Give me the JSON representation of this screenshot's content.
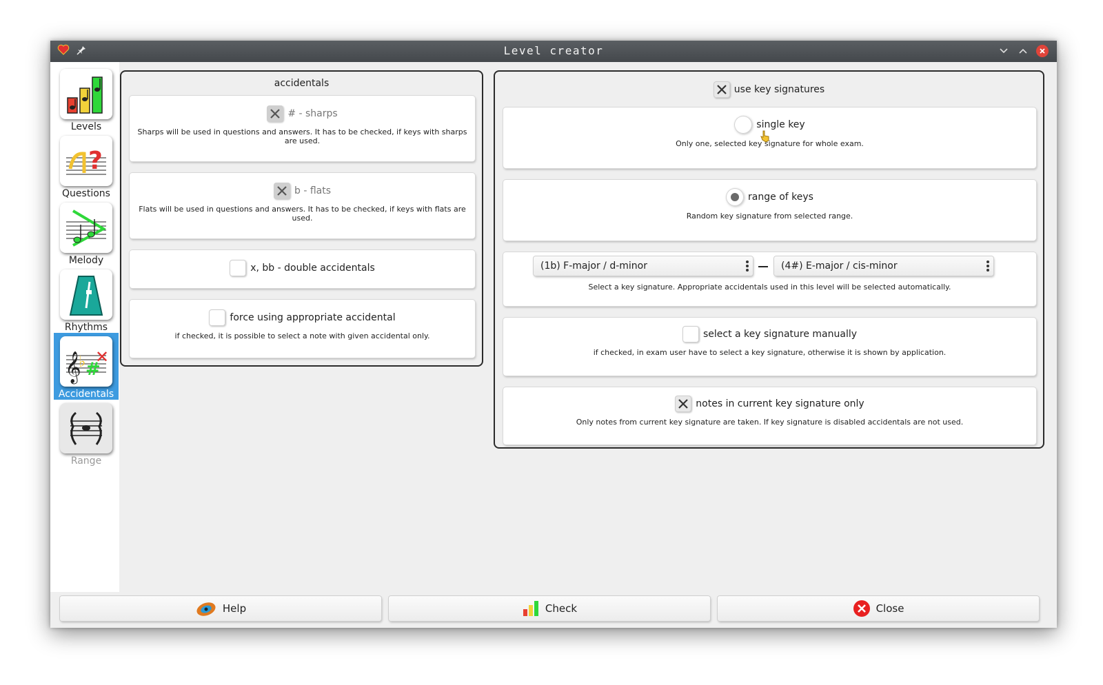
{
  "window": {
    "title": "Level creator"
  },
  "sidebar": {
    "items": [
      {
        "label": "Levels"
      },
      {
        "label": "Questions"
      },
      {
        "label": "Melody"
      },
      {
        "label": "Rhythms"
      },
      {
        "label": "Accidentals"
      },
      {
        "label": "Range"
      }
    ]
  },
  "accidentals": {
    "title": "accidentals",
    "sharps": {
      "label": "# - sharps",
      "checked": true,
      "desc": "Sharps will be used in questions and answers. It has to be checked, if keys with sharps are used."
    },
    "flats": {
      "label": "b - flats",
      "checked": true,
      "desc": "Flats will be used in questions and answers. It has to be checked, if keys with flats are used."
    },
    "double": {
      "label": "x, bb - double accidentals",
      "checked": false
    },
    "force": {
      "label": "force using appropriate accidental",
      "checked": false,
      "desc": "if checked, it is possible to select a note with given accidental only."
    }
  },
  "keys": {
    "use_key_signatures": {
      "label": "use key signatures",
      "checked": true
    },
    "single_key": {
      "label": "single key",
      "selected": false,
      "desc": "Only one, selected key signature for whole exam."
    },
    "range_of_keys": {
      "label": "range of keys",
      "selected": true,
      "desc": "Random key signature from selected range."
    },
    "range": {
      "from": "(1b) F-major / d-minor",
      "to": "(4#) E-major / cis-minor",
      "desc": "Select a key signature. Appropriate accidentals used in this level will be selected automatically."
    },
    "manual": {
      "label": "select a key signature manually",
      "checked": false,
      "desc": "if checked, in exam user have to select a key signature, otherwise it is shown by application."
    },
    "current_only": {
      "label": "notes in current key signature only",
      "checked": true,
      "desc": "Only notes from current key signature are taken. If key signature is disabled accidentals are not used."
    }
  },
  "buttons": {
    "help": "Help",
    "check": "Check",
    "close": "Close"
  },
  "colors": {
    "accent": "#3d9be0",
    "titlebar": "#4a4e52",
    "close": "#e0443a"
  }
}
